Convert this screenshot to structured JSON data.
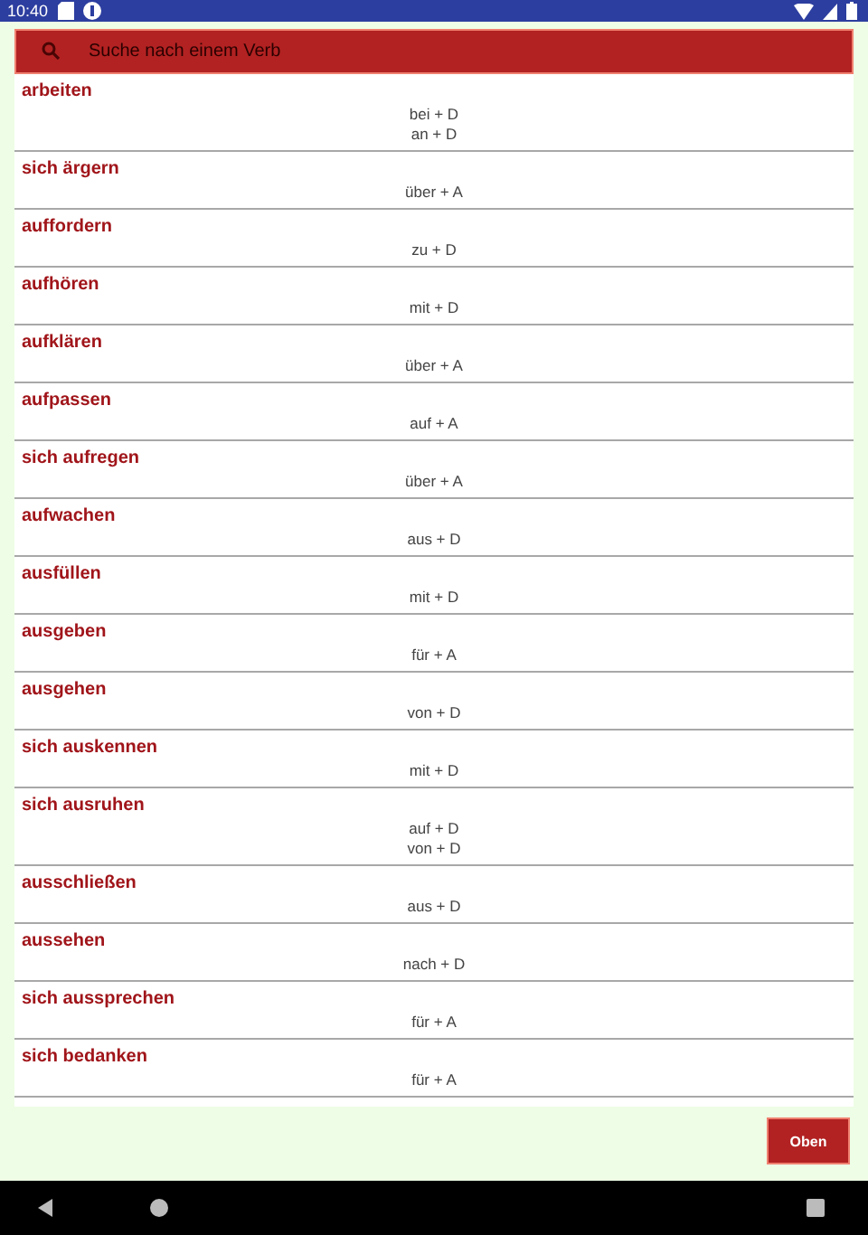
{
  "status_bar": {
    "time": "10:40"
  },
  "search": {
    "placeholder": "Suche nach einem Verb"
  },
  "verbs": [
    {
      "verb": "arbeiten",
      "prepositions": [
        "bei + D",
        "an + D"
      ]
    },
    {
      "verb": "sich ärgern",
      "prepositions": [
        "über + A"
      ]
    },
    {
      "verb": "auffordern",
      "prepositions": [
        "zu + D"
      ]
    },
    {
      "verb": "aufhören",
      "prepositions": [
        "mit + D"
      ]
    },
    {
      "verb": "aufklären",
      "prepositions": [
        "über + A"
      ]
    },
    {
      "verb": "aufpassen",
      "prepositions": [
        "auf + A"
      ]
    },
    {
      "verb": "sich aufregen",
      "prepositions": [
        "über + A"
      ]
    },
    {
      "verb": "aufwachen",
      "prepositions": [
        "aus + D"
      ]
    },
    {
      "verb": "ausfüllen",
      "prepositions": [
        "mit + D"
      ]
    },
    {
      "verb": "ausgeben",
      "prepositions": [
        "für + A"
      ]
    },
    {
      "verb": "ausgehen",
      "prepositions": [
        "von + D"
      ]
    },
    {
      "verb": "sich auskennen",
      "prepositions": [
        "mit + D"
      ]
    },
    {
      "verb": "sich ausruhen",
      "prepositions": [
        "auf + D",
        "von + D"
      ]
    },
    {
      "verb": "ausschließen",
      "prepositions": [
        "aus + D"
      ]
    },
    {
      "verb": "aussehen",
      "prepositions": [
        "nach + D"
      ]
    },
    {
      "verb": "sich aussprechen",
      "prepositions": [
        "für + A"
      ]
    },
    {
      "verb": "sich bedanken",
      "prepositions": [
        "für + A"
      ]
    }
  ],
  "top_button": "Oben"
}
